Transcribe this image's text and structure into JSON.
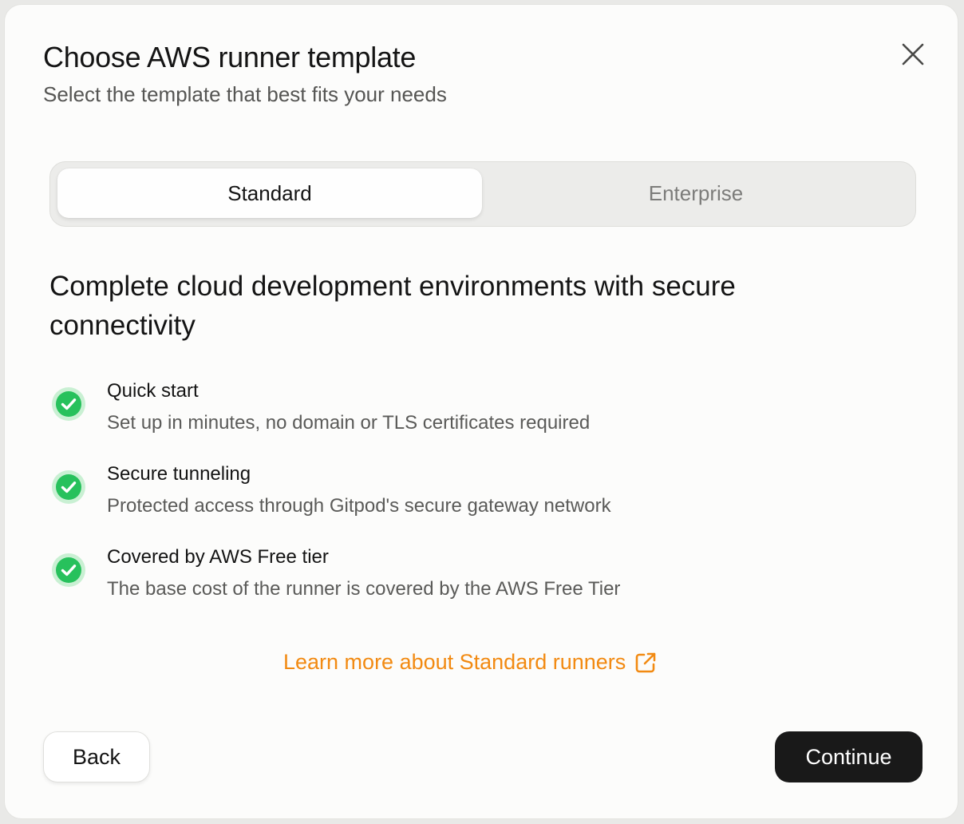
{
  "dialog": {
    "title": "Choose AWS runner template",
    "subtitle": "Select the template that best fits your needs",
    "close_icon": "close-icon"
  },
  "tabs": [
    {
      "label": "Standard",
      "selected": true
    },
    {
      "label": "Enterprise",
      "selected": false
    }
  ],
  "content": {
    "headline": "Complete cloud development environments with secure connectivity",
    "features": [
      {
        "title": "Quick start",
        "description": "Set up in minutes, no domain or TLS certificates required",
        "icon": "check-circle-icon"
      },
      {
        "title": "Secure tunneling",
        "description": "Protected access through Gitpod's secure gateway network",
        "icon": "check-circle-icon"
      },
      {
        "title": "Covered by AWS Free tier",
        "description": "The base cost of the runner is covered by the AWS Free Tier",
        "icon": "check-circle-icon"
      }
    ],
    "learn_more": {
      "label": "Learn more about Standard runners",
      "icon": "external-link-icon"
    }
  },
  "footer": {
    "back_label": "Back",
    "continue_label": "Continue"
  },
  "colors": {
    "accent_link": "#f28a12",
    "check_green": "#27c15c",
    "primary_button": "#191919"
  }
}
